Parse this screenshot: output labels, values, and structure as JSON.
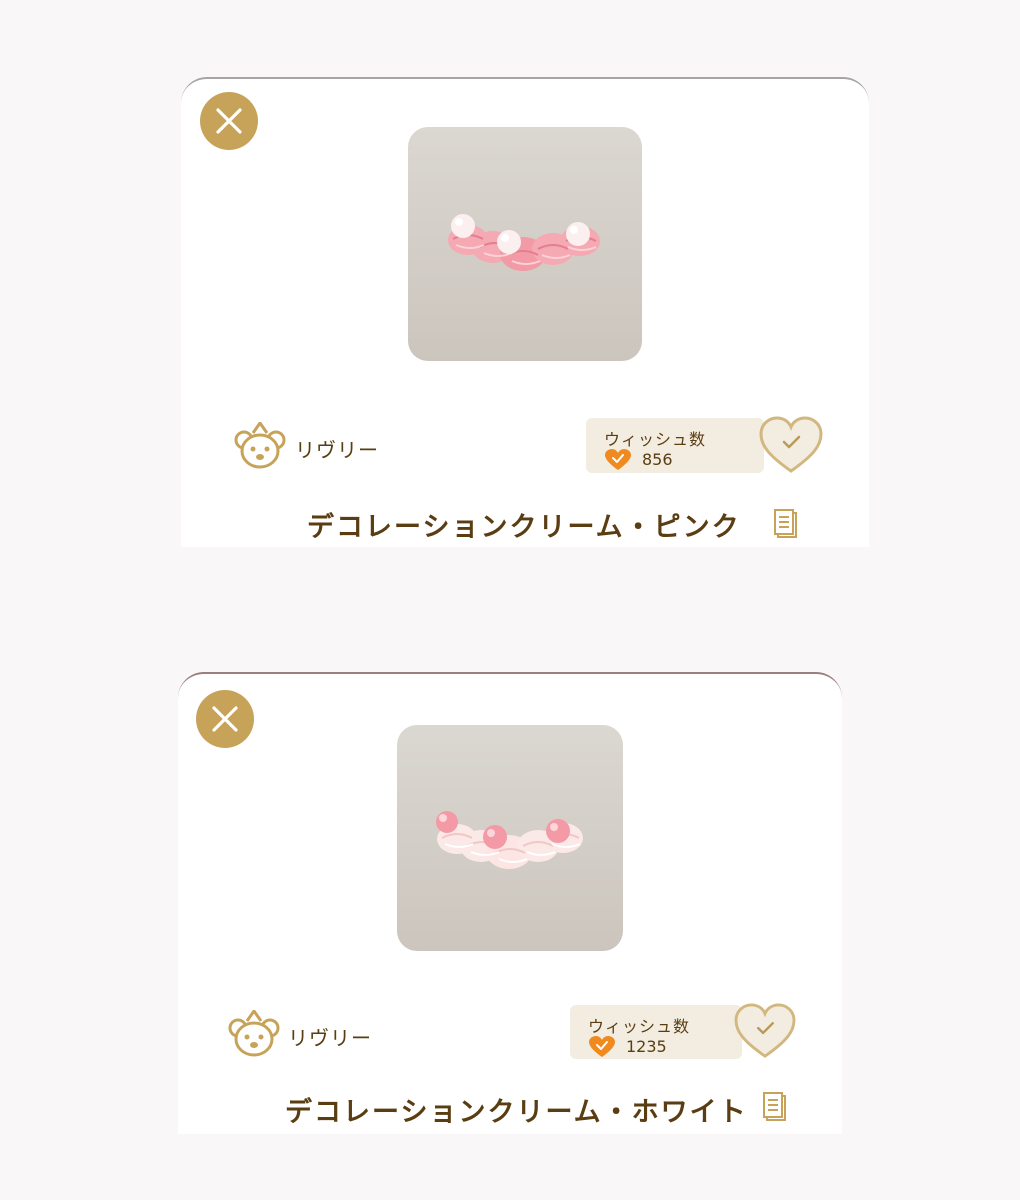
{
  "items": [
    {
      "brand": "リヴリー",
      "wish_label": "ウィッシュ数",
      "wish_count": "856",
      "name": "デコレーションクリーム・ピンク",
      "cream_color": "#f4a9b3",
      "ball_color": "#fbeff0"
    },
    {
      "brand": "リヴリー",
      "wish_label": "ウィッシュ数",
      "wish_count": "1235",
      "name": "デコレーションクリーム・ホワイト",
      "cream_color": "#fbe9e7",
      "ball_color": "#f49aa6"
    }
  ],
  "colors": {
    "gold": "#c7a35a",
    "brown_text": "#5a3d12",
    "wish_orange": "#f08a1e",
    "wish_box_bg": "#f3ede1"
  },
  "icons": {
    "close": "close-icon",
    "brand": "bear-crown-icon",
    "wish": "heart-check-icon",
    "detail": "document-icon"
  }
}
